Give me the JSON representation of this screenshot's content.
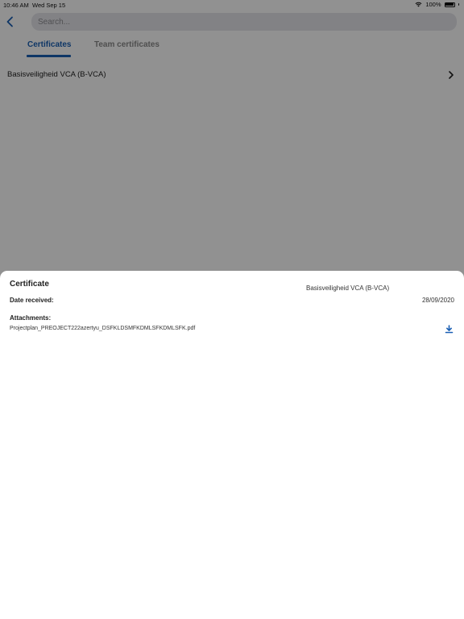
{
  "status_bar": {
    "time": "10:46 AM",
    "date": "Wed Sep 15",
    "battery": "100%"
  },
  "header": {
    "back_icon": "chevron-left-icon",
    "search": {
      "placeholder": "Search...",
      "value": ""
    }
  },
  "tabs": [
    {
      "label": "Certificates",
      "active": true
    },
    {
      "label": "Team certificates",
      "active": false
    }
  ],
  "list": {
    "items": [
      {
        "label": "Basisveiligheid VCA (B-VCA)",
        "icon": "chevron-right-icon"
      }
    ]
  },
  "sheet": {
    "title": "Certificate",
    "certificate_name": "Basisveiligheid VCA (B-VCA)",
    "date_label": "Date received:",
    "date_value": "28/09/2020",
    "attachments_label": "Attachments:",
    "attachments": [
      {
        "filename": "Projectplan_PREOJECT222azertyu_DSFKLDSMFKDMLSFKDMLSFK.pdf",
        "icon": "download-icon"
      }
    ]
  },
  "colors": {
    "accent": "#1a5fb4",
    "overlay": "rgba(0,0,0,0.43)",
    "search_bg": "#e5e5ea"
  }
}
